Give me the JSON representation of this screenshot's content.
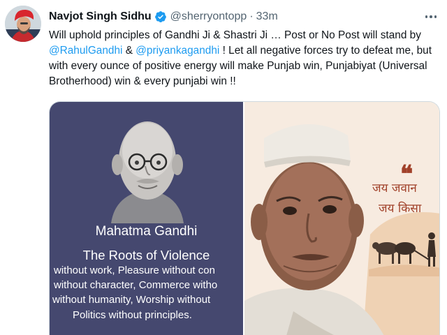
{
  "author": {
    "display_name": "Navjot Singh Sidhu",
    "handle": "@sherryontopp",
    "separator": "·",
    "time": "33m",
    "verified": true
  },
  "tweet": {
    "text_1": "Will uphold principles of Gandhi Ji & Shastri Ji … Post or No Post will stand by ",
    "mention_1": "@RahulGandhi",
    "text_2": " & ",
    "mention_2": "@priyankagandhi",
    "text_3": " ! Let all negative forces try to defeat me, but with every ounce of positive energy will make Punjab win, Punjabiyat (Universal Brotherhood) win & every punjabi win !!"
  },
  "media": {
    "left_image": {
      "name": "Mahatma Gandhi",
      "title": "The Roots of Violence",
      "lines": [
        "without work, Pleasure without con",
        "without character, Commerce witho",
        "without humanity, Worship without",
        "Politics without principles."
      ]
    },
    "right_image": {
      "quote_mark": "❝",
      "hindi_line_1": "जय जवान",
      "hindi_line_2": "जय किसा"
    }
  },
  "colors": {
    "link": "#1d9bf0",
    "verified_badge": "#1d9bf0",
    "left_panel_bg": "#45486f",
    "hindi_text": "#a1412a"
  },
  "icons": {
    "verified": "verified-badge-icon",
    "more": "more-options-icon"
  }
}
